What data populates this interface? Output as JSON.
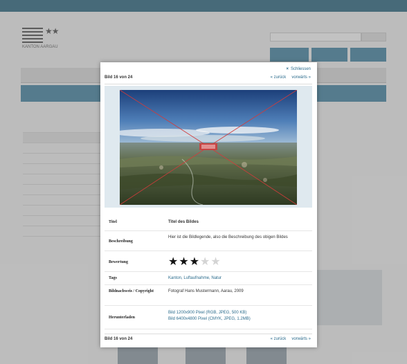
{
  "background": {
    "modal": {
      "close_label": "Schliessen",
      "counter": "Bild 16 von 24",
      "prev_label": "« zurück",
      "next_label": "vorwärts »",
      "info": [
        {
          "label": "Titel",
          "value": "Titel des Bildes"
        },
        {
          "label": "Beschreibung",
          "value": "Hier ist die Bildlegende, also die Beschreibung des obigen Bildes"
        },
        {
          "label": "Bewertung",
          "rating": 3,
          "max": 5
        },
        {
          "label": "Tags",
          "value": "Kanton, Luftaufnahme, Natur"
        },
        {
          "label": "Bildnachweis / Copyright",
          "value": "Fotograf Hans Mustermann, Aarau, 2009"
        },
        {
          "label": "Herunterladen",
          "value": "Bild 1200x900 Pixel (RGB, JPEG, 500 KB)",
          "value2": "Bild 6400x4800 Pixel (CMYK, JPEG, 1.2MB)"
        }
      ]
    },
    "logo_text": "KANTON AARGAU"
  }
}
